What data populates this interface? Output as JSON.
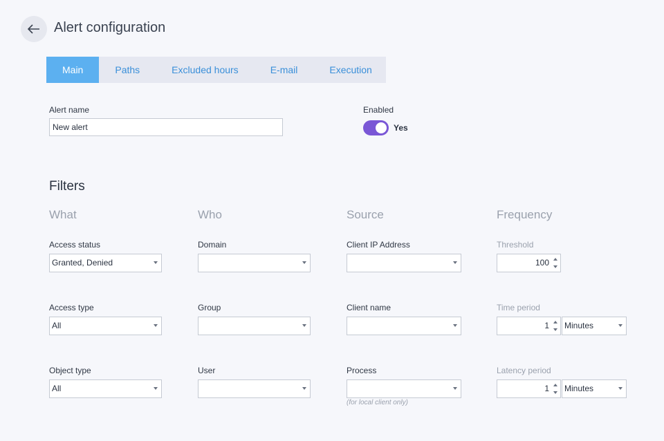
{
  "header": {
    "title": "Alert configuration",
    "back_icon": "arrow-left-icon"
  },
  "tabs": [
    {
      "label": "Main",
      "active": true
    },
    {
      "label": "Paths",
      "active": false
    },
    {
      "label": "Excluded hours",
      "active": false
    },
    {
      "label": "E-mail",
      "active": false
    },
    {
      "label": "Execution",
      "active": false
    }
  ],
  "main": {
    "alert_name_label": "Alert name",
    "alert_name_value": "New alert",
    "enabled_label": "Enabled",
    "enabled_value": "Yes",
    "enabled_on": true
  },
  "filters": {
    "title": "Filters",
    "what": {
      "heading": "What",
      "access_status": {
        "label": "Access status",
        "value": "Granted, Denied"
      },
      "access_type": {
        "label": "Access type",
        "value": "All"
      },
      "object_type": {
        "label": "Object type",
        "value": "All"
      }
    },
    "who": {
      "heading": "Who",
      "domain": {
        "label": "Domain",
        "value": ""
      },
      "group": {
        "label": "Group",
        "value": ""
      },
      "user": {
        "label": "User",
        "value": ""
      }
    },
    "source": {
      "heading": "Source",
      "client_ip": {
        "label": "Client IP Address",
        "value": ""
      },
      "client_name": {
        "label": "Client name",
        "value": ""
      },
      "process": {
        "label": "Process",
        "value": "",
        "hint": "(for local client only)"
      }
    },
    "frequency": {
      "heading": "Frequency",
      "threshold": {
        "label": "Threshold",
        "value": "100"
      },
      "time_period": {
        "label": "Time period",
        "value": "1",
        "unit": "Minutes"
      },
      "latency_period": {
        "label": "Latency period",
        "value": "1",
        "unit": "Minutes"
      }
    }
  },
  "colors": {
    "accent_tab": "#5cb0f0",
    "toggle": "#7a57d6",
    "tab_text": "#3a8fd9"
  }
}
